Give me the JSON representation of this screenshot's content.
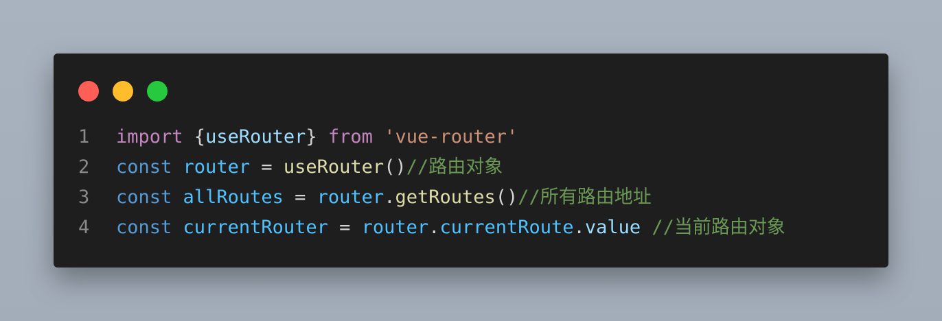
{
  "colors": {
    "background": "#a9b3bf",
    "window": "#1e1e1e",
    "close": "#ff5f56",
    "minimize": "#ffbd2e",
    "maximize": "#27c93f"
  },
  "window_controls": [
    "close-dot",
    "minimize-dot",
    "maximize-dot"
  ],
  "lines": [
    {
      "number": "1",
      "tokens": [
        {
          "text": "import",
          "kind": "kw-import"
        },
        {
          "text": " {",
          "kind": "punc"
        },
        {
          "text": "useRouter",
          "kind": "var"
        },
        {
          "text": "} ",
          "kind": "punc"
        },
        {
          "text": "from",
          "kind": "kw-import"
        },
        {
          "text": " ",
          "kind": "punc"
        },
        {
          "text": "'vue-router'",
          "kind": "str"
        }
      ]
    },
    {
      "number": "2",
      "tokens": [
        {
          "text": "const",
          "kind": "kw-const"
        },
        {
          "text": " ",
          "kind": "punc"
        },
        {
          "text": "router",
          "kind": "vardef"
        },
        {
          "text": " = ",
          "kind": "punc"
        },
        {
          "text": "useRouter",
          "kind": "fn"
        },
        {
          "text": "()",
          "kind": "punc"
        },
        {
          "text": "//路由对象",
          "kind": "cmt"
        }
      ]
    },
    {
      "number": "3",
      "tokens": [
        {
          "text": "const",
          "kind": "kw-const"
        },
        {
          "text": " ",
          "kind": "punc"
        },
        {
          "text": "allRoutes",
          "kind": "vardef"
        },
        {
          "text": " = ",
          "kind": "punc"
        },
        {
          "text": "router",
          "kind": "vardef"
        },
        {
          "text": ".",
          "kind": "punc"
        },
        {
          "text": "getRoutes",
          "kind": "fn"
        },
        {
          "text": "()",
          "kind": "punc"
        },
        {
          "text": "//所有路由地址",
          "kind": "cmt"
        }
      ]
    },
    {
      "number": "4",
      "tokens": [
        {
          "text": "const",
          "kind": "kw-const"
        },
        {
          "text": " ",
          "kind": "punc"
        },
        {
          "text": "currentRouter",
          "kind": "vardef"
        },
        {
          "text": " = ",
          "kind": "punc"
        },
        {
          "text": "router",
          "kind": "vardef"
        },
        {
          "text": ".",
          "kind": "punc"
        },
        {
          "text": "currentRoute",
          "kind": "vardef"
        },
        {
          "text": ".",
          "kind": "punc"
        },
        {
          "text": "value",
          "kind": "var"
        },
        {
          "text": " ",
          "kind": "punc"
        },
        {
          "text": "//当前路由对象",
          "kind": "cmt"
        }
      ]
    }
  ]
}
